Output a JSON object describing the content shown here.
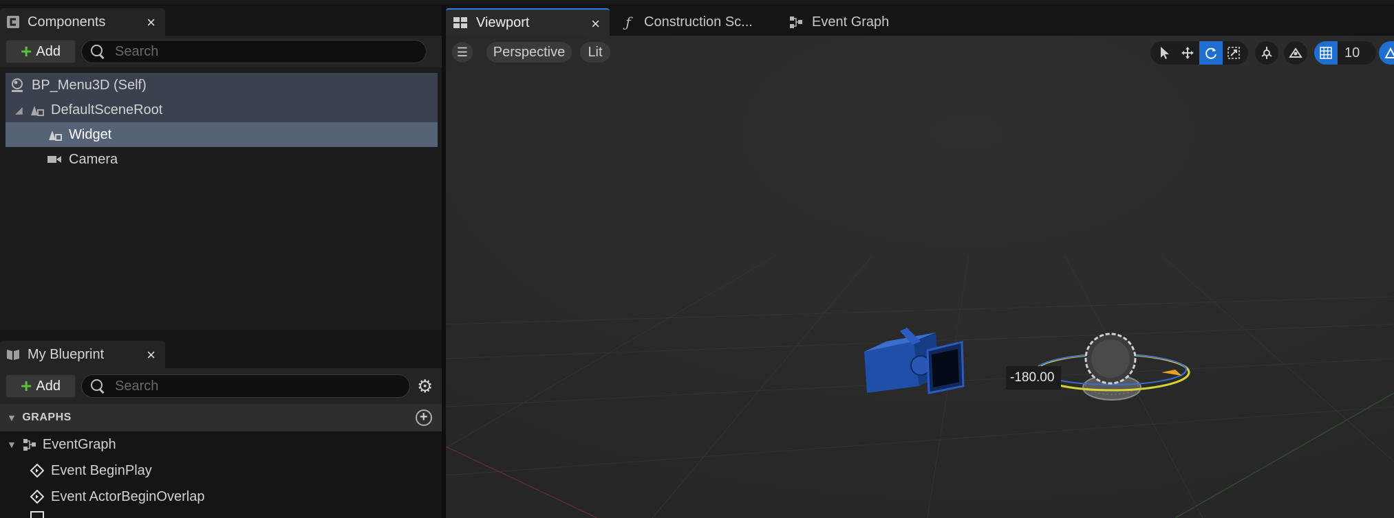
{
  "components_panel": {
    "tab_label": "Components",
    "add_label": "Add",
    "search_placeholder": "Search",
    "tree": [
      {
        "label": "BP_Menu3D (Self)",
        "icon": "actor-icon"
      },
      {
        "label": "DefaultSceneRoot",
        "icon": "scene-component-icon"
      },
      {
        "label": "Widget",
        "icon": "widget-component-icon"
      },
      {
        "label": "Camera",
        "icon": "camera-icon"
      }
    ]
  },
  "my_blueprint_panel": {
    "tab_label": "My Blueprint",
    "add_label": "Add",
    "search_placeholder": "Search",
    "section_label": "GRAPHS",
    "items": [
      {
        "label": "EventGraph",
        "icon": "graph-icon"
      },
      {
        "label": "Event BeginPlay",
        "icon": "event-icon"
      },
      {
        "label": "Event ActorBeginOverlap",
        "icon": "event-icon"
      }
    ]
  },
  "editor_tabs": [
    {
      "label": "Viewport",
      "icon": "viewport-icon",
      "active": true
    },
    {
      "label": "Construction Sc...",
      "icon": "function-icon",
      "active": false
    },
    {
      "label": "Event Graph",
      "icon": "graph-icon",
      "active": false
    }
  ],
  "viewport_toolbar": {
    "view_mode": "Perspective",
    "lighting": "Lit",
    "grid_snap_value": "10",
    "active_tool": "rotate"
  },
  "gizmo": {
    "rotation_readout": "-180.00"
  },
  "colors": {
    "accent": "#1e6fcf",
    "add_plus": "#58c13a",
    "selection": "#566376"
  }
}
